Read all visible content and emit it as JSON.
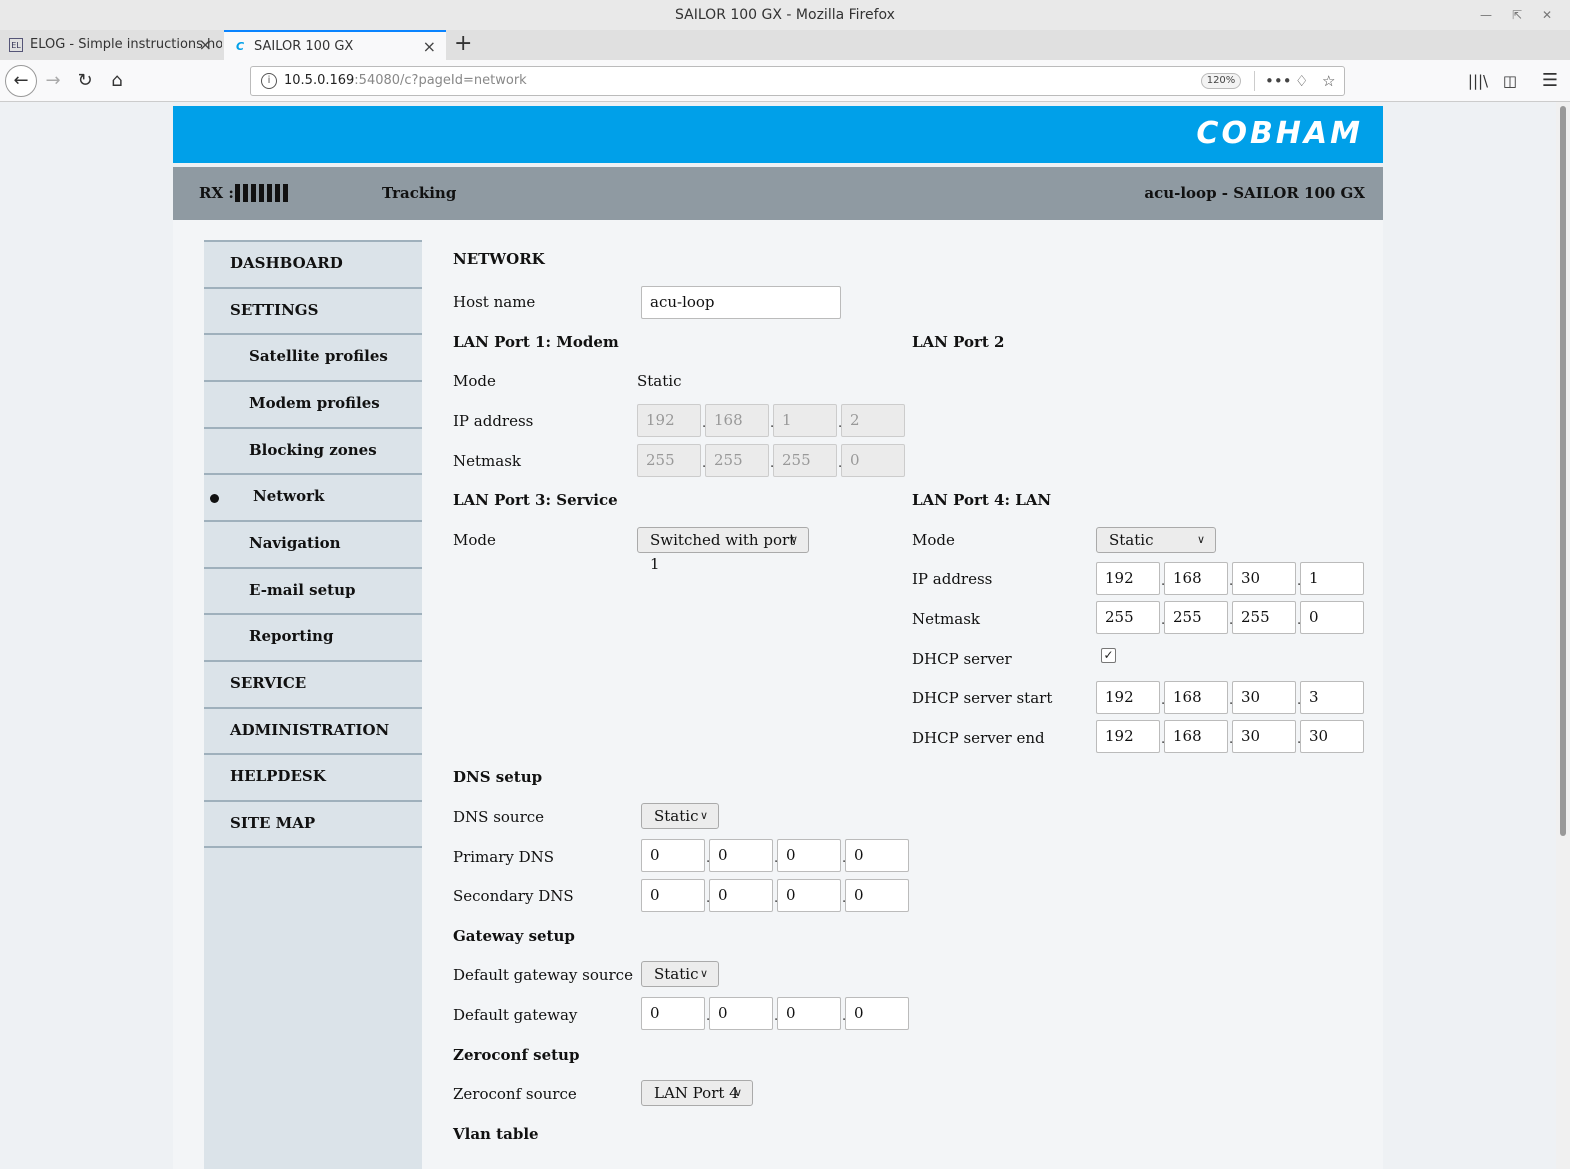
{
  "window": {
    "title": "SAILOR 100 GX - Mozilla Firefox"
  },
  "tabs": [
    {
      "label": "ELOG - Simple instructions ho",
      "favicon": "EL"
    },
    {
      "label": "SAILOR 100 GX",
      "favicon": "C"
    }
  ],
  "url": {
    "host": "10.5.0.169",
    "rest": ":54080/c?pageId=network",
    "zoom": "120%"
  },
  "brand": {
    "logo": "COBHAM",
    "banner_color": "#00a0e9"
  },
  "status": {
    "rx_label": "RX :",
    "rx_bars": 7,
    "tracking": "Tracking",
    "device": "acu-loop - SAILOR 100 GX"
  },
  "menu": [
    {
      "label": "DASHBOARD"
    },
    {
      "label": "SETTINGS"
    },
    {
      "label": "Satellite profiles"
    },
    {
      "label": "Modem profiles"
    },
    {
      "label": "Blocking zones"
    },
    {
      "label": "Network",
      "active": true
    },
    {
      "label": "Navigation"
    },
    {
      "label": "E-mail setup"
    },
    {
      "label": "Reporting"
    },
    {
      "label": "SERVICE"
    },
    {
      "label": "ADMINISTRATION"
    },
    {
      "label": "HELPDESK"
    },
    {
      "label": "SITE MAP"
    }
  ],
  "page": {
    "title": "NETWORK",
    "host_label": "Host name",
    "host_value": "acu-loop",
    "lan1": {
      "title": "LAN Port 1: Modem",
      "mode_label": "Mode",
      "mode_value": "Static",
      "ip_label": "IP address",
      "ip": [
        "192",
        "168",
        "1",
        "2"
      ],
      "mask_label": "Netmask",
      "mask": [
        "255",
        "255",
        "255",
        "0"
      ]
    },
    "lan2": {
      "title": "LAN Port 2"
    },
    "lan3": {
      "title": "LAN Port 3: Service",
      "mode_label": "Mode",
      "mode_value": "Switched with port 1"
    },
    "lan4": {
      "title": "LAN Port 4: LAN",
      "mode_label": "Mode",
      "mode_value": "Static",
      "ip_label": "IP address",
      "ip": [
        "192",
        "168",
        "30",
        "1"
      ],
      "mask_label": "Netmask",
      "mask": [
        "255",
        "255",
        "255",
        "0"
      ],
      "dhcp_label": "DHCP server",
      "dhcp_checked": true,
      "dhcp_start_label": "DHCP server start",
      "dhcp_start": [
        "192",
        "168",
        "30",
        "3"
      ],
      "dhcp_end_label": "DHCP server end",
      "dhcp_end": [
        "192",
        "168",
        "30",
        "30"
      ]
    },
    "dns": {
      "title": "DNS setup",
      "source_label": "DNS source",
      "source_value": "Static",
      "primary_label": "Primary DNS",
      "primary": [
        "0",
        "0",
        "0",
        "0"
      ],
      "secondary_label": "Secondary DNS",
      "secondary": [
        "0",
        "0",
        "0",
        "0"
      ]
    },
    "gateway": {
      "title": "Gateway setup",
      "source_label": "Default gateway source",
      "source_value": "Static",
      "gw_label": "Default gateway",
      "gw": [
        "0",
        "0",
        "0",
        "0"
      ]
    },
    "zeroconf": {
      "title": "Zeroconf setup",
      "source_label": "Zeroconf source",
      "source_value": "LAN Port 4"
    },
    "vlan": {
      "title": "Vlan table"
    }
  }
}
